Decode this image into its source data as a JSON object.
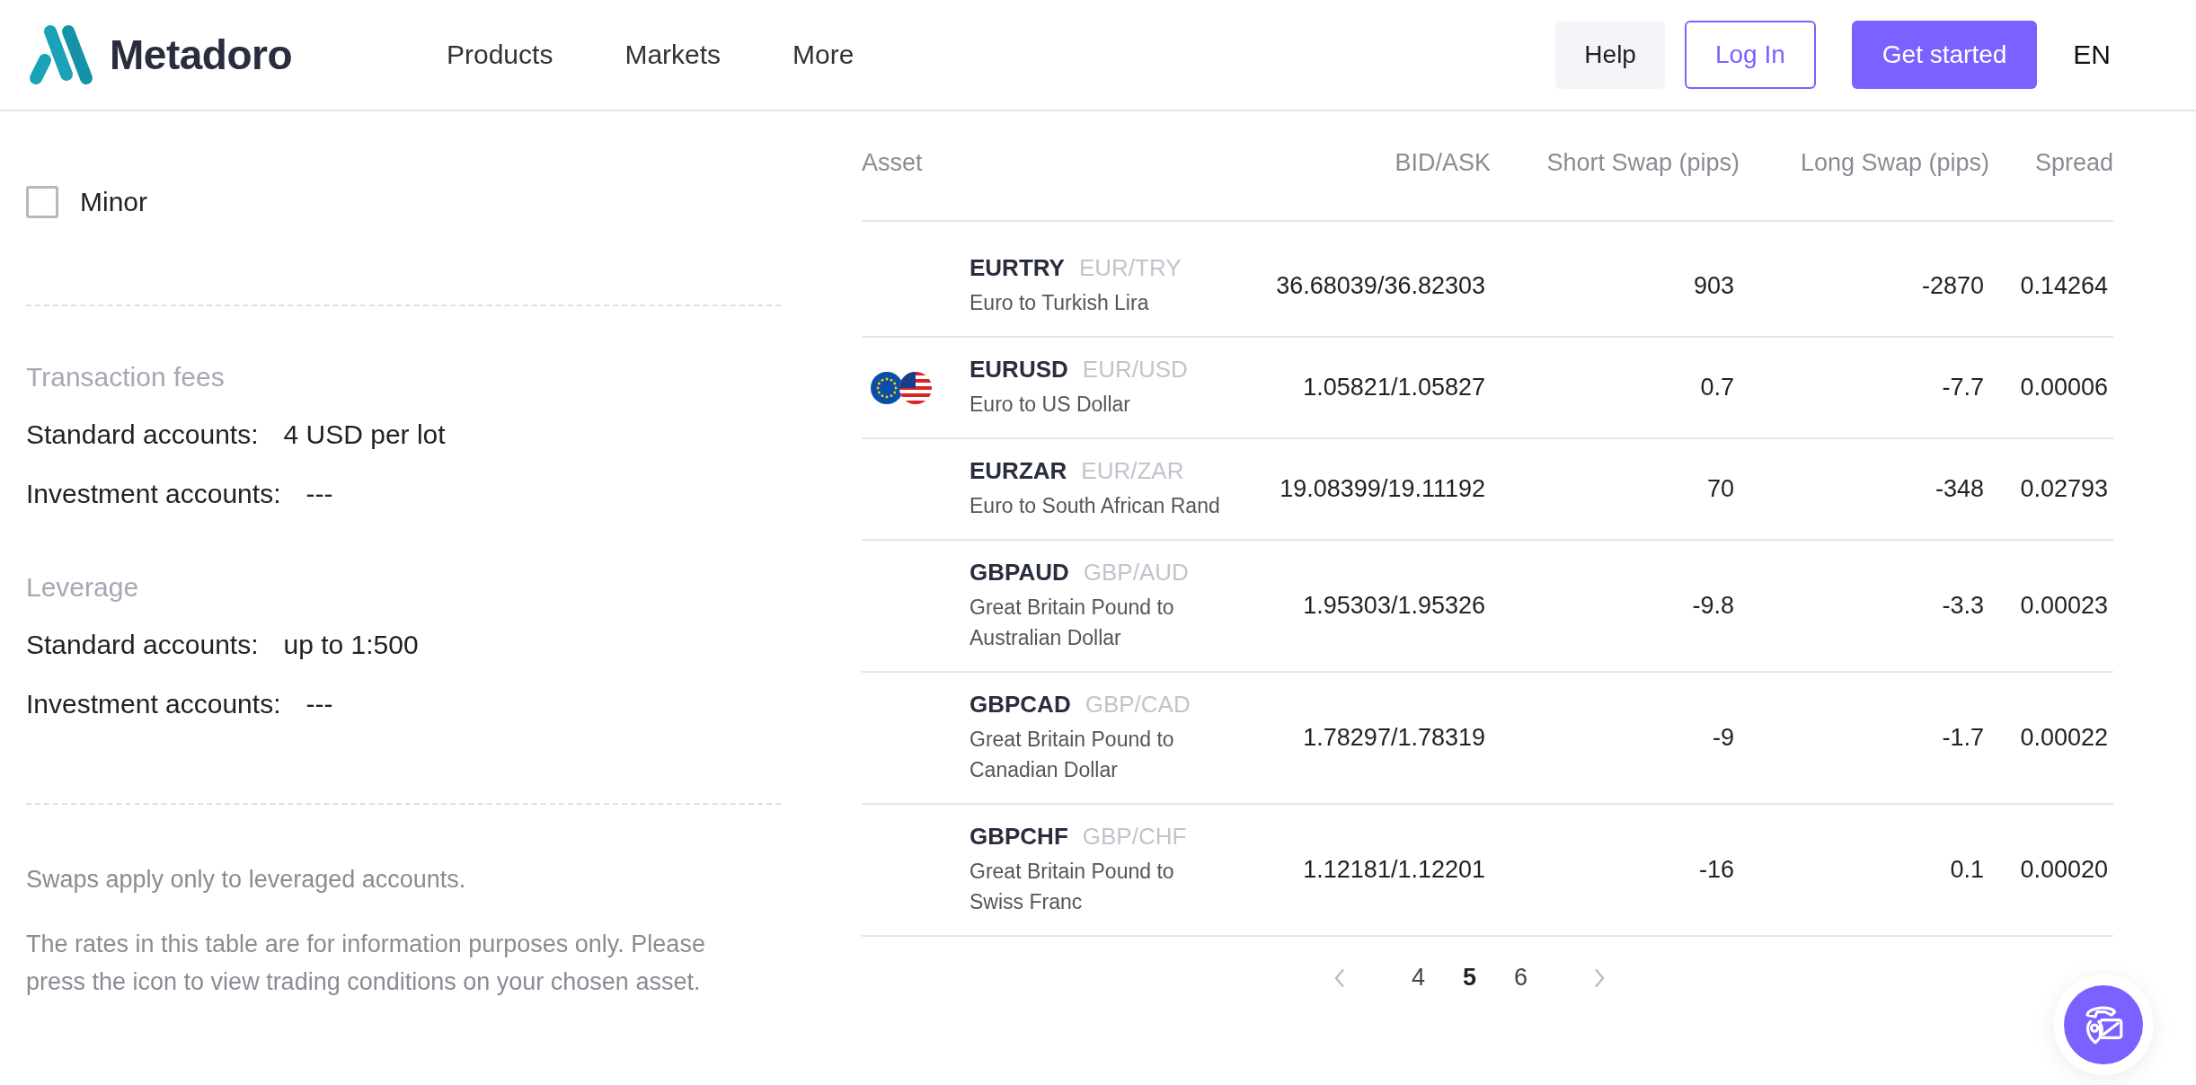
{
  "header": {
    "brand": "Metadoro",
    "nav": [
      "Products",
      "Markets",
      "More"
    ],
    "help": "Help",
    "login": "Log In",
    "get_started": "Get started",
    "language": "EN"
  },
  "filters": [
    {
      "label": "Minor",
      "checked": false
    }
  ],
  "sections": [
    {
      "title": "Transaction fees",
      "rows": [
        {
          "label": "Standard accounts:",
          "value": "4 USD per lot"
        },
        {
          "label": "Investment accounts:",
          "value": "---"
        }
      ]
    },
    {
      "title": "Leverage",
      "rows": [
        {
          "label": "Standard accounts:",
          "value": "up to 1:500"
        },
        {
          "label": "Investment accounts:",
          "value": "---"
        }
      ]
    }
  ],
  "notes": [
    "Swaps apply only to leveraged accounts.",
    "The rates in this table are for information purposes only. Please press the icon to view trading conditions on your chosen asset."
  ],
  "table": {
    "columns": [
      "Asset",
      "BID/ASK",
      "Short Swap (pips)",
      "Long Swap (pips)",
      "Spread"
    ],
    "rows": [
      {
        "symbol": "EURTRY",
        "pair": "EUR/TRY",
        "description": "Euro to Turkish Lira",
        "bid_ask": "36.68039/36.82303",
        "short_swap": "903",
        "long_swap": "-2870",
        "spread": "0.14264",
        "flags": false
      },
      {
        "symbol": "EURUSD",
        "pair": "EUR/USD",
        "description": "Euro to US Dollar",
        "bid_ask": "1.05821/1.05827",
        "short_swap": "0.7",
        "long_swap": "-7.7",
        "spread": "0.00006",
        "flags": true
      },
      {
        "symbol": "EURZAR",
        "pair": "EUR/ZAR",
        "description": "Euro to South African Rand",
        "bid_ask": "19.08399/19.11192",
        "short_swap": "70",
        "long_swap": "-348",
        "spread": "0.02793",
        "flags": false
      },
      {
        "symbol": "GBPAUD",
        "pair": "GBP/AUD",
        "description": "Great Britain Pound to Australian Dollar",
        "bid_ask": "1.95303/1.95326",
        "short_swap": "-9.8",
        "long_swap": "-3.3",
        "spread": "0.00023",
        "flags": false
      },
      {
        "symbol": "GBPCAD",
        "pair": "GBP/CAD",
        "description": "Great Britain Pound to Canadian Dollar",
        "bid_ask": "1.78297/1.78319",
        "short_swap": "-9",
        "long_swap": "-1.7",
        "spread": "0.00022",
        "flags": false
      },
      {
        "symbol": "GBPCHF",
        "pair": "GBP/CHF",
        "description": "Great Britain Pound to Swiss Franc",
        "bid_ask": "1.12181/1.12201",
        "short_swap": "-16",
        "long_swap": "0.1",
        "spread": "0.00020",
        "flags": false
      }
    ]
  },
  "pagination": {
    "prev_disabled": true,
    "next_disabled": true,
    "pages": [
      {
        "label": "4",
        "selected": false
      },
      {
        "label": "5",
        "selected": true
      },
      {
        "label": "6",
        "selected": false
      }
    ]
  }
}
